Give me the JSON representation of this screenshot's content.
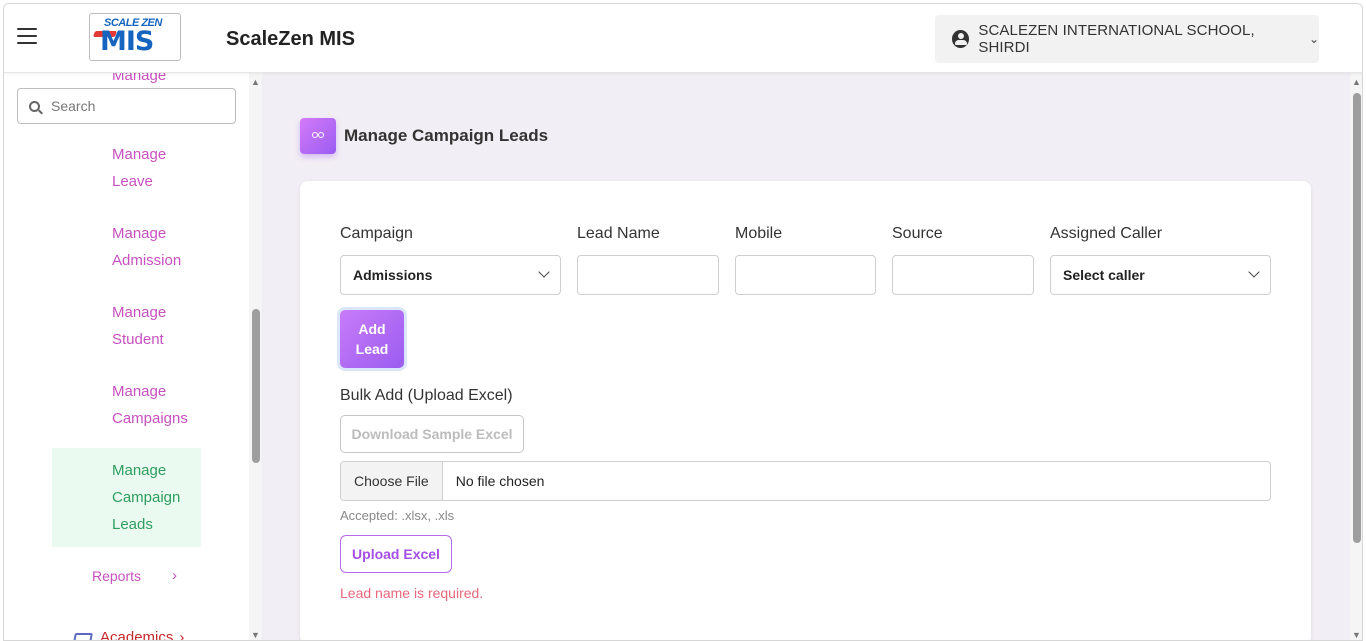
{
  "header": {
    "logo_top": "SCALE ZEN",
    "logo_main": "MIS",
    "app_title": "ScaleZen MIS",
    "school": "SCALEZEN INTERNATIONAL SCHOOL, SHIRDI",
    "school_chevron": "⌄"
  },
  "sidebar": {
    "partial_top": "Manage",
    "search_placeholder": "Search",
    "items": [
      {
        "line1": "Manage",
        "line2": "Leave"
      },
      {
        "line1": "Manage",
        "line2": "Admission"
      },
      {
        "line1": "Manage",
        "line2": "Student"
      },
      {
        "line1": "Manage",
        "line2": "Campaigns"
      },
      {
        "line1": "Manage",
        "line2": "Campaign",
        "line3": "Leads"
      }
    ],
    "reports": "Reports",
    "reports_arrow": "›",
    "academics": "Academics",
    "academics_arrow": "›",
    "scroll_up": "▲",
    "scroll_down": "▼"
  },
  "main": {
    "title": "Manage Campaign Leads",
    "scroll_up": "▲",
    "scroll_down": "▼",
    "form": {
      "campaign_label": "Campaign",
      "campaign_value": "Admissions",
      "lead_name_label": "Lead Name",
      "lead_name_value": "",
      "mobile_label": "Mobile",
      "mobile_value": "",
      "source_label": "Source",
      "source_value": "",
      "caller_label": "Assigned Caller",
      "caller_value": "Select caller",
      "add_line1": "Add",
      "add_line2": "Lead"
    },
    "bulk": {
      "label": "Bulk Add (Upload Excel)",
      "download_btn": "Download Sample Excel",
      "choose_file": "Choose File",
      "file_status": "No file chosen",
      "accepted": "Accepted: .xlsx, .xls",
      "upload_btn": "Upload Excel"
    },
    "error": "Lead name is required."
  },
  "colors": {
    "accent": "#a64fe6",
    "nav_text": "#c850c0",
    "active_nav_bg": "#eafaf0",
    "active_nav_text": "#2e9d60",
    "error": "#e8677c",
    "page_bg": "#f2eef5"
  }
}
